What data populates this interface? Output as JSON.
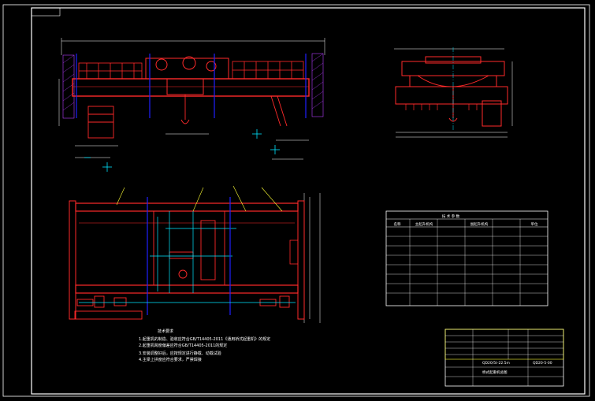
{
  "drawing": {
    "layer_colors": {
      "background": "#000000",
      "structure": "#ff2a2a",
      "centerline": "#2020ff",
      "auxiliary": "#00e5ff",
      "dimension": "#ffffff",
      "leader": "#ffff33",
      "frame": "#ffffff"
    }
  },
  "notes": {
    "title": "技术要求",
    "items": [
      "1.起重机的制造、验收应符合GB/T14405-2011《通用桥式起重机》的规定",
      "2.起重机跨度偏差应符合GB/T14405-2011的规定",
      "3.安装调整好后，应按规定进行静载、动载试验",
      "4.主梁上拱度应符合要求，严禁焊接"
    ]
  },
  "spec_table": {
    "title": "技 术 参 数",
    "headers": [
      "名称",
      "主起升机构",
      "副起升机构",
      "单位"
    ]
  },
  "title_block": {
    "drawing_title": "QD20/5t-22.5m",
    "drawing_subtitle": "桥式起重机总图",
    "drawing_no": "QD20-5-00"
  }
}
